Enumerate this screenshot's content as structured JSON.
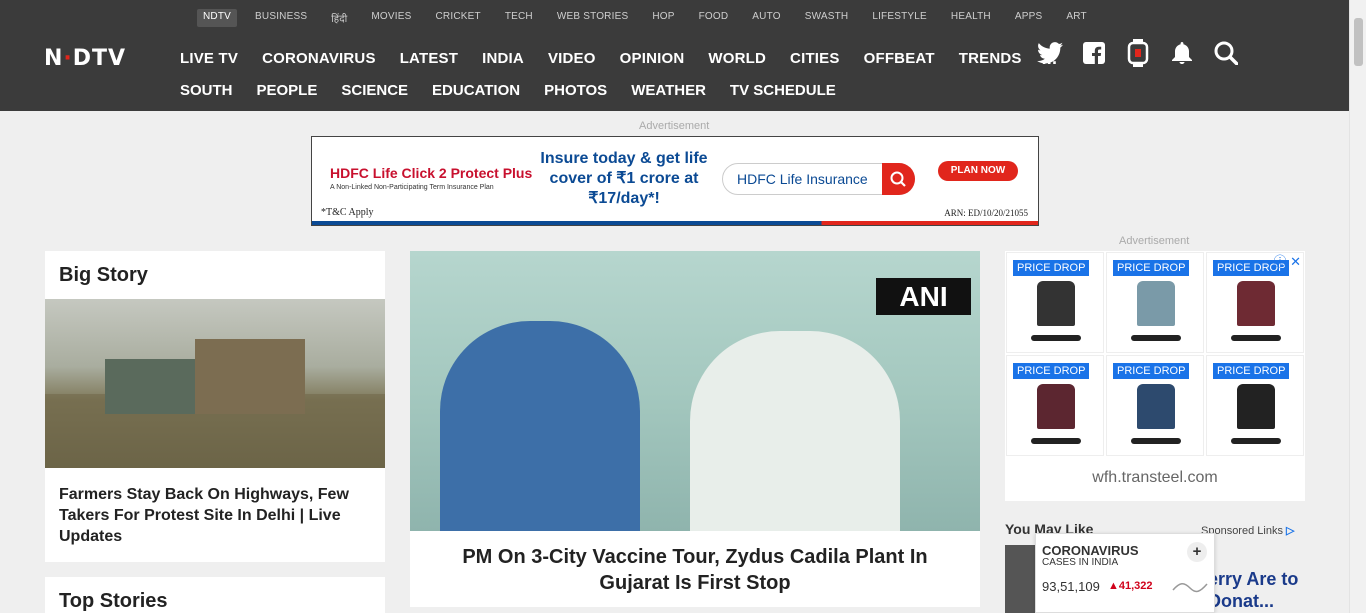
{
  "subnav": [
    "NDTV",
    "BUSINESS",
    "हिंदी",
    "MOVIES",
    "CRICKET",
    "TECH",
    "WEB STORIES",
    "HOP",
    "FOOD",
    "AUTO",
    "SWASTH",
    "LIFESTYLE",
    "HEALTH",
    "APPS",
    "ART"
  ],
  "logo": "NDTV",
  "mainnav": [
    "LIVE TV",
    "CORONAVIRUS",
    "LATEST",
    "INDIA",
    "VIDEO",
    "OPINION",
    "WORLD",
    "CITIES",
    "OFFBEAT",
    "TRENDS"
  ],
  "more": "...",
  "mainnav2": [
    "SOUTH",
    "PEOPLE",
    "SCIENCE",
    "EDUCATION",
    "PHOTOS",
    "WEATHER",
    "TV SCHEDULE"
  ],
  "ad_label": "Advertisement",
  "banner": {
    "brand": "HDFC Life Click 2 Protect Plus",
    "brand_sub": "A Non-Linked Non-Participating Term Insurance Plan",
    "tagline": "Insure today & get life cover of ₹1 crore at ₹17/day*!",
    "search_text": "HDFC Life Insurance",
    "cta": "PLAN NOW",
    "tc": "*T&C Apply",
    "arn": "ARN: ED/10/20/21055"
  },
  "big_story": {
    "heading": "Big Story",
    "caption": "Farmers Stay Back On Highways, Few Takers For Protest Site In Delhi | Live Updates"
  },
  "top_stories": {
    "heading": "Top Stories"
  },
  "main_story": {
    "watermark": "ANI",
    "headline": "PM On 3-City Vaccine Tour, Zydus Cadila Plant In Gujarat Is First Stop"
  },
  "right_ad": {
    "badge": "PRICE DROP",
    "site": "wfh.transteel.com",
    "chair_colors": [
      "#333333",
      "#7a9aa8",
      "#6e2a33",
      "#5c2630",
      "#2d4a6e",
      "#222222"
    ]
  },
  "you_may_like": {
    "heading": "You May Like",
    "sponsored": "Sponsored Links",
    "teaser": "erry Are to Donat..."
  },
  "corona": {
    "title": "CORONAVIRUS",
    "subtitle": "CASES IN INDIA",
    "count": "93,51,109",
    "delta": "41,322"
  }
}
